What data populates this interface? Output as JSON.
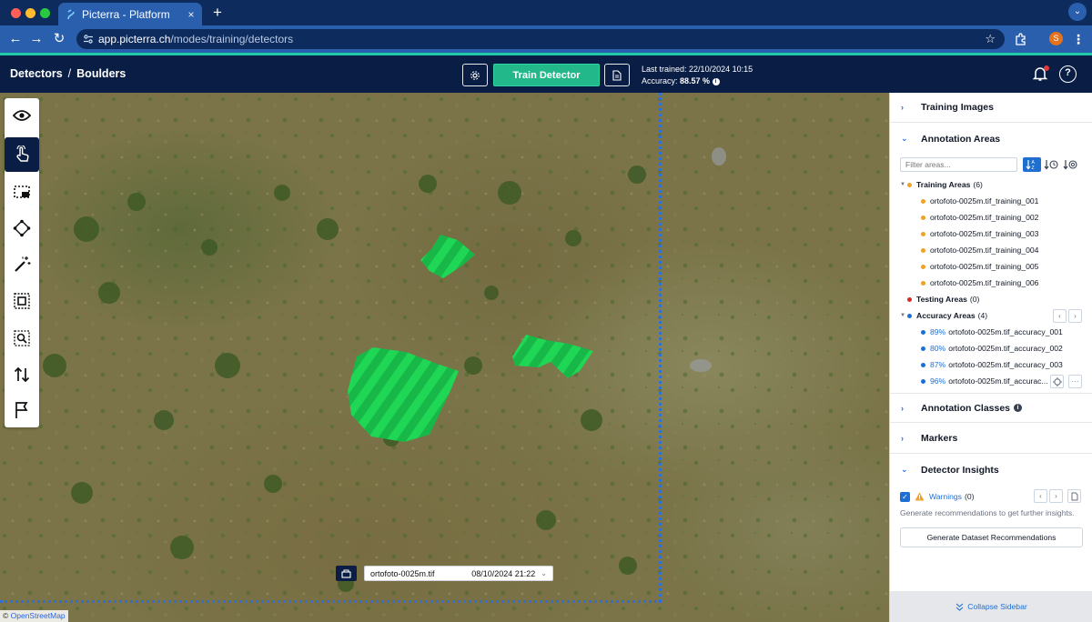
{
  "browser": {
    "tab_title": "Picterra - Platform",
    "tab_close": "×",
    "new_tab": "+",
    "url_host": "app.picterra.ch",
    "url_path": "/modes/training/detectors",
    "profile_initial": "S",
    "menu": "⋮",
    "chevron": "⌄",
    "back": "←",
    "forward": "→",
    "reload": "↻",
    "star": "☆"
  },
  "header": {
    "breadcrumb_root": "Detectors",
    "breadcrumb_sep": "/",
    "breadcrumb_current": "Boulders",
    "train_button": "Train Detector",
    "last_trained_label": "Last trained:",
    "last_trained_value": "22/10/2024 10:15",
    "accuracy_label": "Accuracy:",
    "accuracy_value": "88.57 %",
    "help": "?"
  },
  "map": {
    "attribution_symbol": "©",
    "attribution": "OpenStreetMap",
    "image_name": "ortofoto-0025m.tif",
    "image_date": "08/10/2024 21:22",
    "image_chevron": "⌄",
    "annotation_color": "#22c55e",
    "tools": [
      "eye-icon",
      "hand-pointer-icon",
      "rectangle-select-icon",
      "polygon-icon",
      "magic-wand-icon",
      "frame-select-icon",
      "zoom-area-icon",
      "sort-arrows-icon",
      "flag-icon"
    ]
  },
  "sidebar": {
    "training_images": "Training Images",
    "annotation_areas": "Annotation Areas",
    "filter_placeholder": "Filter areas...",
    "sort_az": "↓Z",
    "training_group": {
      "label": "Training Areas",
      "count": "(6)"
    },
    "training_items": [
      "ortofoto-0025m.tif_training_001",
      "ortofoto-0025m.tif_training_002",
      "ortofoto-0025m.tif_training_003",
      "ortofoto-0025m.tif_training_004",
      "ortofoto-0025m.tif_training_005",
      "ortofoto-0025m.tif_training_006"
    ],
    "testing_group": {
      "label": "Testing Areas",
      "count": "(0)"
    },
    "accuracy_group": {
      "label": "Accuracy Areas",
      "count": "(4)"
    },
    "accuracy_items": [
      {
        "pct": "89%",
        "name": "ortofoto-0025m.tif_accuracy_001"
      },
      {
        "pct": "80%",
        "name": "ortofoto-0025m.tif_accuracy_002"
      },
      {
        "pct": "87%",
        "name": "ortofoto-0025m.tif_accuracy_003"
      },
      {
        "pct": "96%",
        "name": "ortofoto-0025m.tif_accurac..."
      }
    ],
    "annotation_classes": "Annotation Classes",
    "markers": "Markers",
    "detector_insights": "Detector Insights",
    "warnings_label": "Warnings",
    "warnings_count": "(0)",
    "hint": "Generate recommendations to get further insights.",
    "generate_button": "Generate Dataset Recommendations",
    "collapse": "Collapse Sidebar",
    "more": "···",
    "prev": "‹",
    "next": "›",
    "chevron_right": "›",
    "chevron_down": "⌄",
    "caret": "▼",
    "check": "✓",
    "info": "i"
  },
  "colors": {
    "header_bg": "#0a1e45",
    "accent_green": "#23b88a",
    "link_blue": "#1d6fd6",
    "training_dot": "#f0a12a",
    "testing_dot": "#d62b2b",
    "accuracy_dot": "#1d6fd6"
  }
}
